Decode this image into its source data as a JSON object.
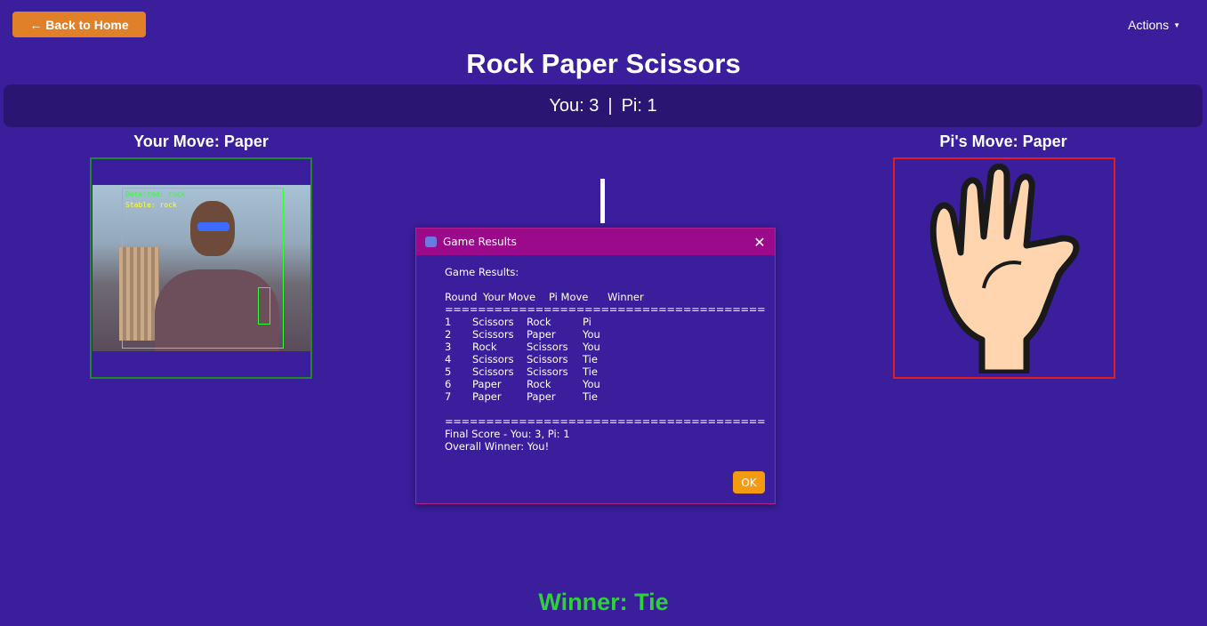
{
  "nav": {
    "back_label": "← Back to Home",
    "actions_label": "Actions",
    "actions_caret": "▼"
  },
  "title": "Rock Paper Scissors",
  "score": {
    "you": "You: 3",
    "sep": "|",
    "pi": "Pi: 1"
  },
  "your_move": {
    "label": "Your Move: Paper",
    "overlay_detected": "Detected: rock",
    "overlay_stable": "Stable: rock"
  },
  "pi_move": {
    "label": "Pi's Move: Paper",
    "icon": "open-hand-icon"
  },
  "winner": "Winner: Tie",
  "colors": {
    "background": "#3a1e9c",
    "scorebar": "#2a1573",
    "back_button": "#e0812a",
    "winner": "#2fd13a",
    "your_frame": "#1e8a2a",
    "pi_frame": "#e11d1d",
    "dialog_titlebar": "#9b0a8a",
    "ok_button": "#f39a10"
  },
  "dialog": {
    "title": "Game Results",
    "heading": "Game Results:",
    "columns": [
      "Round",
      "Your Move",
      "Pi Move",
      "Winner"
    ],
    "divider": "========================================",
    "rows": [
      [
        "1",
        "Scissors",
        "Rock",
        "Pi"
      ],
      [
        "2",
        "Scissors",
        "Paper",
        "You"
      ],
      [
        "3",
        "Rock",
        "Scissors",
        "You"
      ],
      [
        "4",
        "Scissors",
        "Scissors",
        "Tie"
      ],
      [
        "5",
        "Scissors",
        "Scissors",
        "Tie"
      ],
      [
        "6",
        "Paper",
        "Rock",
        "You"
      ],
      [
        "7",
        "Paper",
        "Paper",
        "Tie"
      ]
    ],
    "final_score": "Final Score - You: 3, Pi: 1",
    "overall_winner": "Overall Winner: You!",
    "ok_label": "OK"
  }
}
